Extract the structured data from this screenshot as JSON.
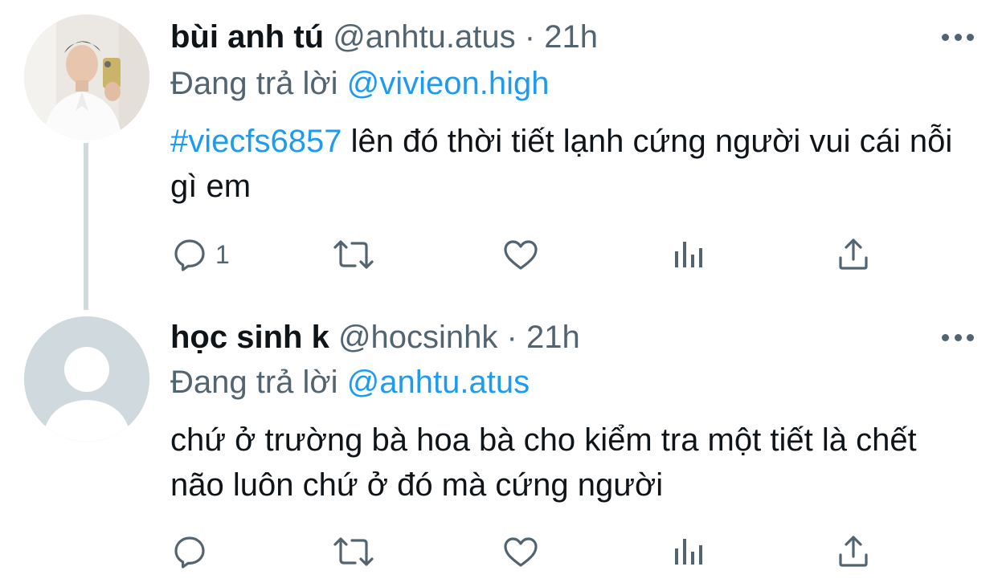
{
  "tweets": [
    {
      "display_name": "bùi anh tú",
      "handle": "@anhtu.atus",
      "separator": "·",
      "time": "21h",
      "replying_to_label": "Đang trả lời",
      "replying_to_handle": "@vivieon.high",
      "hashtag": "#viecfs6857",
      "text": "lên đó thời tiết lạnh cứng người vui cái nỗi gì em",
      "reply_count": "1",
      "avatar": "profile-photo",
      "has_thread_line": true
    },
    {
      "display_name": "học sinh k",
      "handle": "@hocsinhk",
      "separator": "·",
      "time": "21h",
      "replying_to_label": "Đang trả lời",
      "replying_to_handle": "@anhtu.atus",
      "hashtag": "",
      "text": "chứ ở trường bà hoa bà cho kiểm tra một tiết là chết não luôn chứ ở đó mà cứng người",
      "reply_count": "",
      "avatar": "default-avatar",
      "has_thread_line": false
    }
  ],
  "icons": {
    "reply": "reply-icon",
    "retweet": "retweet-icon",
    "like": "heart-icon",
    "analytics": "analytics-icon",
    "share": "share-icon",
    "more": "more-icon"
  },
  "colors": {
    "link": "#1d9bf0",
    "secondary_text": "#536471",
    "primary_text": "#0f1419",
    "thread_line": "#cfd9de",
    "default_avatar_bg": "#cfd9de"
  }
}
